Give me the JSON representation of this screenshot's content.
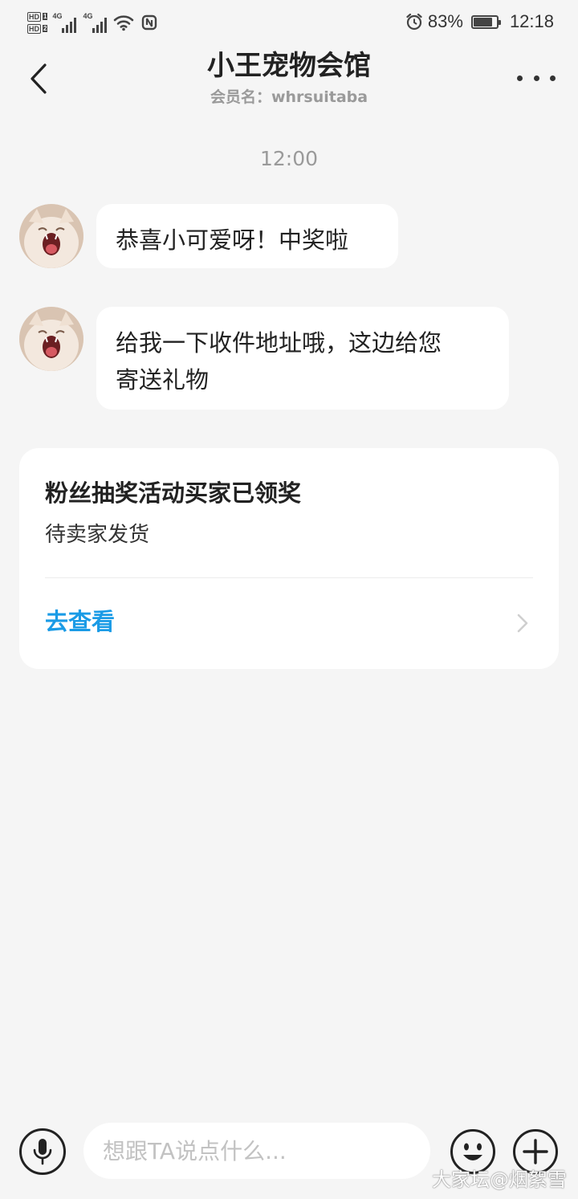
{
  "status_bar": {
    "hd1": "HD",
    "hd1_num": "1",
    "hd2": "HD",
    "hd2_num": "2",
    "network1": "4G",
    "network2": "4G",
    "battery_percent": "83%",
    "battery_level": 0.83,
    "time": "12:18",
    "icons": [
      "hd-icon",
      "signal-icon",
      "wifi-icon",
      "nfc-icon",
      "alarm-icon",
      "battery-icon"
    ]
  },
  "header": {
    "title": "小王宠物会馆",
    "subtitle": "会员名：whrsuitaba",
    "back_icon": "chevron-left-icon",
    "more_icon": "more-icon"
  },
  "chat": {
    "timestamp": "12:00",
    "messages": [
      {
        "text": "恭喜小可爱呀！中奖啦"
      },
      {
        "text": "给我一下收件地址哦，这边给您\n寄送礼物"
      }
    ]
  },
  "card": {
    "title": "粉丝抽奖活动买家已领奖",
    "subtitle": "待卖家发货",
    "link_label": "去查看",
    "link_color": "#1a9be6"
  },
  "input_bar": {
    "placeholder": "想跟TA说点什么...",
    "value": "",
    "icons": [
      "microphone-icon",
      "emoji-icon",
      "plus-icon"
    ]
  },
  "watermark": "大家坛@烟絮雪"
}
